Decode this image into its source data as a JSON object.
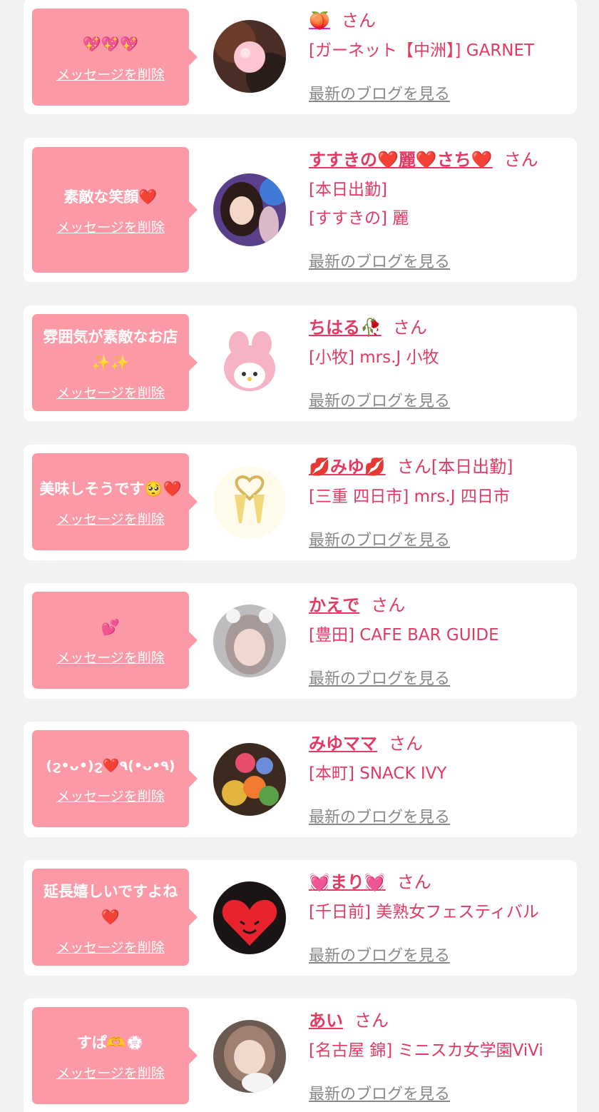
{
  "colors": {
    "page_bg": "#f2f2f2",
    "card_bg": "#ffffff",
    "bubble_bg": "#fb9aa6",
    "name_pink": "#e23a63",
    "link_gray": "#888888",
    "heart_red": "#ee1b2e"
  },
  "common": {
    "delete_label": "メッセージを削除",
    "blog_label": "最新のブログを見る",
    "san_label": "さん"
  },
  "items": [
    {
      "message": "💖💖💖",
      "name": "🍑",
      "extra": "",
      "details": [
        "[ガーネット【中洲】] GARNET"
      ],
      "avatar_icon": "blurred-photo-with-peach-sticker"
    },
    {
      "message": "素敵な笑顔❤️",
      "name": "すすきの❤️麗❤️さち❤️",
      "extra": "",
      "details": [
        "[本日出勤]",
        "[すすきの] 麗"
      ],
      "avatar_icon": "photo-woman-with-balloons"
    },
    {
      "message": "雰囲気が素敵なお店✨✨",
      "name": "ちはる🥀",
      "extra": "",
      "details": [
        "[小牧] mrs.J 小牧"
      ],
      "avatar_icon": "pink-bunny-plush"
    },
    {
      "message": "美味しそうです🥺❤️",
      "name": "💋みゆ💋",
      "extra": "[本日出勤]",
      "details": [
        "[三重 四日市] mrs.J 四日市"
      ],
      "avatar_icon": "champagne-glasses-heart"
    },
    {
      "message": "💕",
      "name": "かえで",
      "extra": "",
      "details": [
        "[豊田] CAFE BAR GUIDE"
      ],
      "avatar_icon": "photo-woman-dog-filter"
    },
    {
      "message": "(ϩ•ᴗ•)ϩ❤️٩(•ᴗ•٩)",
      "name": "みゆママ",
      "extra": "",
      "details": [
        "[本町] SNACK IVY"
      ],
      "avatar_icon": "photo-flower-stand"
    },
    {
      "message": "延長嬉しいですよね❤️",
      "name": "💓まり💓",
      "extra": "",
      "details": [
        "[千日前] 美熟女フェスティバル"
      ],
      "avatar_icon": "red-heart-character"
    },
    {
      "message": "すぱ🫶💮",
      "name": "あい",
      "extra": "",
      "details": [
        "[名古屋 錦] ミニスカ女学園ViVi"
      ],
      "avatar_icon": "photo-woman-with-plush"
    }
  ]
}
